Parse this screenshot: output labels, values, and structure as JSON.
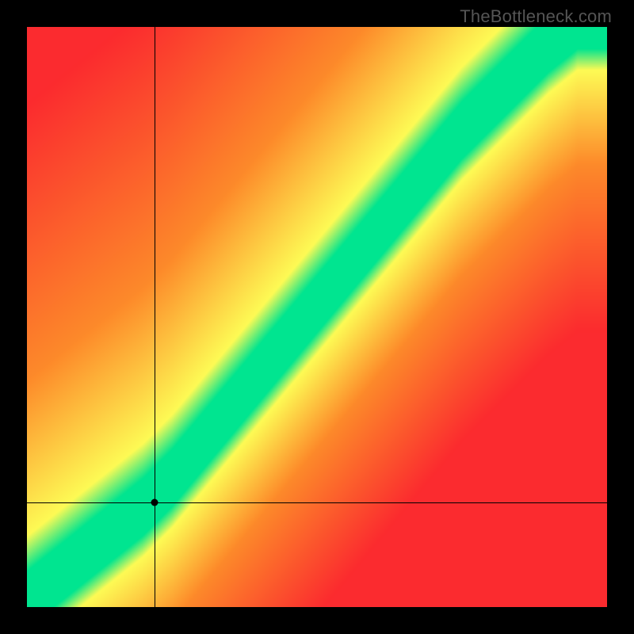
{
  "watermark": "TheBottleneck.com",
  "colors": {
    "red": "#fb2b2f",
    "orange": "#fd8a2a",
    "yellow": "#fdfb55",
    "green": "#00e590",
    "black": "#000000"
  },
  "chart_data": {
    "type": "heatmap",
    "title": "",
    "xlabel": "",
    "ylabel": "",
    "xlim": [
      0,
      100
    ],
    "ylim": [
      0,
      100
    ],
    "crosshair": {
      "x": 22,
      "y": 18
    },
    "marker": {
      "x": 22,
      "y": 18
    },
    "ridge": {
      "description": "Optimal diagonal band (green) from bottom-left to top-right; outside band transitions yellow→orange→red",
      "points_xy": [
        [
          0,
          0
        ],
        [
          5,
          4
        ],
        [
          10,
          8
        ],
        [
          15,
          12
        ],
        [
          20,
          16
        ],
        [
          25,
          21
        ],
        [
          30,
          27
        ],
        [
          35,
          33
        ],
        [
          40,
          39
        ],
        [
          45,
          45
        ],
        [
          50,
          51
        ],
        [
          55,
          57
        ],
        [
          60,
          63
        ],
        [
          65,
          69
        ],
        [
          70,
          75
        ],
        [
          75,
          81
        ],
        [
          80,
          86
        ],
        [
          85,
          91
        ],
        [
          90,
          96
        ],
        [
          95,
          100
        ]
      ],
      "band_halfwidth_pct": 4
    },
    "field": {
      "description": "Each cell score is distance from ridge; 0=green, moderate=yellow/orange, far=red. Upper-left and lower-right corners are reddest.",
      "asymmetry": "below-ridge falls off faster to red than above-ridge"
    }
  }
}
